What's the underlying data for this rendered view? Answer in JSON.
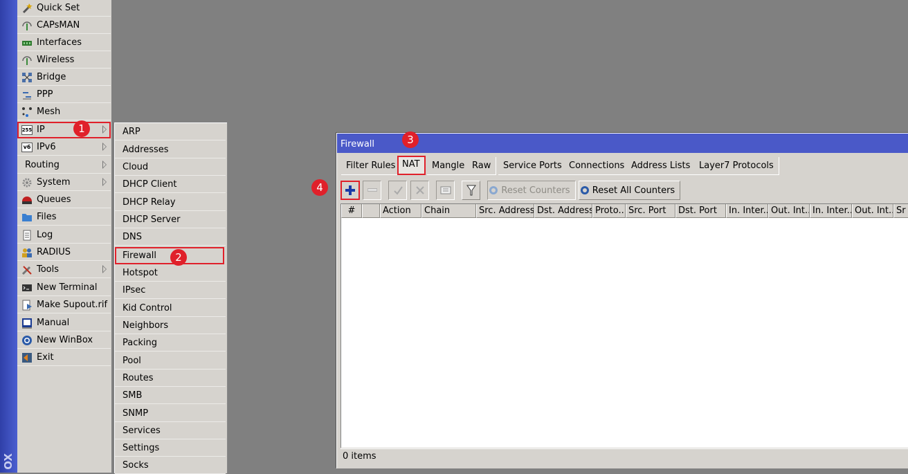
{
  "sidebar": {
    "brand": "OX",
    "items": [
      {
        "label": "Quick Set",
        "icon": "wand-icon",
        "submenu": false
      },
      {
        "label": "CAPsMAN",
        "icon": "antenna-icon",
        "submenu": false
      },
      {
        "label": "Interfaces",
        "icon": "interfaces-icon",
        "submenu": false
      },
      {
        "label": "Wireless",
        "icon": "wireless-icon",
        "submenu": false
      },
      {
        "label": "Bridge",
        "icon": "bridge-icon",
        "submenu": false
      },
      {
        "label": "PPP",
        "icon": "ppp-icon",
        "submenu": false
      },
      {
        "label": "Mesh",
        "icon": "mesh-icon",
        "submenu": false
      },
      {
        "label": "IP",
        "icon": "ip-icon",
        "submenu": true,
        "icon_text": "255"
      },
      {
        "label": "IPv6",
        "icon": "ipv6-icon",
        "submenu": true,
        "icon_text": "v6"
      },
      {
        "label": "Routing",
        "icon": "",
        "submenu": true
      },
      {
        "label": "System",
        "icon": "gear-icon",
        "submenu": true
      },
      {
        "label": "Queues",
        "icon": "queues-icon",
        "submenu": false
      },
      {
        "label": "Files",
        "icon": "folder-icon",
        "submenu": false
      },
      {
        "label": "Log",
        "icon": "log-icon",
        "submenu": false
      },
      {
        "label": "RADIUS",
        "icon": "users-icon",
        "submenu": false
      },
      {
        "label": "Tools",
        "icon": "tools-icon",
        "submenu": true
      },
      {
        "label": "New Terminal",
        "icon": "terminal-icon",
        "submenu": false
      },
      {
        "label": "Make Supout.rif",
        "icon": "supout-icon",
        "submenu": false
      },
      {
        "label": "Manual",
        "icon": "manual-icon",
        "submenu": false
      },
      {
        "label": "New WinBox",
        "icon": "winbox-icon",
        "submenu": false
      },
      {
        "label": "Exit",
        "icon": "exit-icon",
        "submenu": false
      }
    ]
  },
  "ip_submenu": {
    "items": [
      "ARP",
      "Addresses",
      "Cloud",
      "DHCP Client",
      "DHCP Relay",
      "DHCP Server",
      "DNS",
      "Firewall",
      "Hotspot",
      "IPsec",
      "Kid Control",
      "Neighbors",
      "Packing",
      "Pool",
      "Routes",
      "SMB",
      "SNMP",
      "Services",
      "Settings",
      "Socks"
    ]
  },
  "badges": {
    "one": "1",
    "two": "2",
    "three": "3",
    "four": "4"
  },
  "firewall": {
    "title": "Firewall",
    "tabs": [
      "Filter Rules",
      "NAT",
      "Mangle",
      "Raw",
      "Service Ports",
      "Connections",
      "Address Lists",
      "Layer7 Protocols"
    ],
    "active_tab": "NAT",
    "toolbar": {
      "reset_counters": "Reset Counters",
      "reset_all_counters": "Reset All Counters"
    },
    "columns": [
      "#",
      "",
      "Action",
      "Chain",
      "Src. Address",
      "Dst. Address",
      "Proto...",
      "Src. Port",
      "Dst. Port",
      "In. Inter...",
      "Out. Int...",
      "In. Inter...",
      "Out. Int...",
      "Sr"
    ],
    "status": "0 items"
  },
  "colors": {
    "accent_red": "#e0202a",
    "title_bar": "#4a59c8",
    "menu_bg": "#d6d3ce",
    "desktop": "#808080"
  }
}
